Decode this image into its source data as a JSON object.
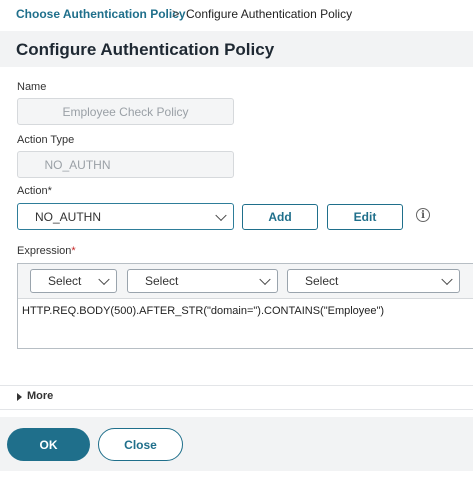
{
  "breadcrumb": {
    "parent": "Choose Authentication Policy",
    "separator": ">",
    "current": "Configure Authentication Policy"
  },
  "page": {
    "title": "Configure Authentication Policy"
  },
  "form": {
    "name": {
      "label": "Name",
      "value": "Employee Check Policy"
    },
    "action_type": {
      "label": "Action Type",
      "value": "NO_AUTHN"
    },
    "action": {
      "label": "Action",
      "required_mark": "*",
      "value": "NO_AUTHN",
      "add_label": "Add",
      "edit_label": "Edit",
      "info_glyph": "i"
    },
    "expression": {
      "label": "Expression",
      "required_mark": "*",
      "selects": [
        "Select",
        "Select",
        "Select"
      ],
      "value": "HTTP.REQ.BODY(500).AFTER_STR(\"domain=\").CONTAINS(\"Employee\")"
    }
  },
  "more": {
    "label": "More"
  },
  "footer": {
    "ok_label": "OK",
    "close_label": "Close"
  },
  "colors": {
    "accent": "#1f6f8b",
    "required": "#c62828",
    "band": "#f2f3f4"
  }
}
